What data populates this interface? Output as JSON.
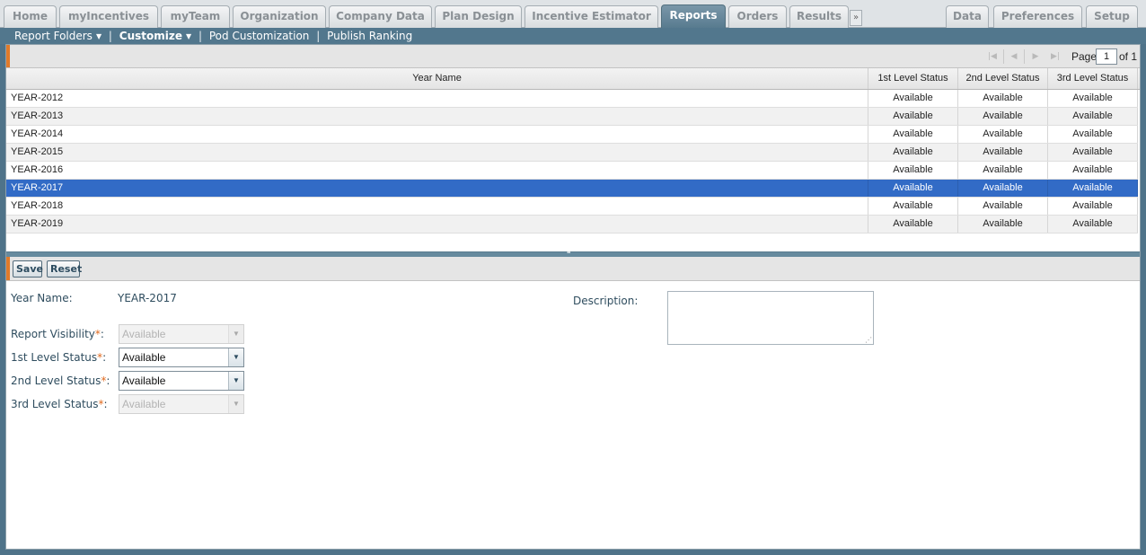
{
  "nav": {
    "tabs_left": [
      "Home",
      "myIncentives",
      "myTeam",
      "Organization",
      "Company Data",
      "Plan Design",
      "Incentive Estimator",
      "Reports",
      "Orders",
      "Results"
    ],
    "more_label": "»",
    "tabs_right": [
      "Data",
      "Preferences",
      "Setup"
    ],
    "active_tab": "Reports"
  },
  "subnav": {
    "items": [
      "Report Folders",
      "Customize",
      "Pod Customization",
      "Publish Ranking"
    ],
    "separator": "|"
  },
  "pager": {
    "page_label": "Page",
    "current_page": "1",
    "of_label": "of 1"
  },
  "grid": {
    "columns": [
      "Year Name",
      "1st Level Status",
      "2nd Level Status",
      "3rd Level Status"
    ],
    "rows": [
      {
        "name": "YEAR-2012",
        "s1": "Available",
        "s2": "Available",
        "s3": "Available"
      },
      {
        "name": "YEAR-2013",
        "s1": "Available",
        "s2": "Available",
        "s3": "Available"
      },
      {
        "name": "YEAR-2014",
        "s1": "Available",
        "s2": "Available",
        "s3": "Available"
      },
      {
        "name": "YEAR-2015",
        "s1": "Available",
        "s2": "Available",
        "s3": "Available"
      },
      {
        "name": "YEAR-2016",
        "s1": "Available",
        "s2": "Available",
        "s3": "Available"
      },
      {
        "name": "YEAR-2017",
        "s1": "Available",
        "s2": "Available",
        "s3": "Available"
      },
      {
        "name": "YEAR-2018",
        "s1": "Available",
        "s2": "Available",
        "s3": "Available"
      },
      {
        "name": "YEAR-2019",
        "s1": "Available",
        "s2": "Available",
        "s3": "Available"
      }
    ],
    "selected_row": 5
  },
  "form_toolbar": {
    "save_label": "Save",
    "reset_label": "Reset"
  },
  "form": {
    "year_name_label": "Year Name:",
    "year_name_value": "YEAR-2017",
    "description_label": "Description:",
    "description_value": "",
    "required_mark": "*",
    "report_visibility": {
      "label": "Report Visibility",
      "value": "Available",
      "disabled": true
    },
    "level1": {
      "label": "1st Level Status",
      "value": "Available",
      "disabled": false
    },
    "level2": {
      "label": "2nd Level Status",
      "value": "Available",
      "disabled": false
    },
    "level3": {
      "label": "3rd Level Status",
      "value": "Available",
      "disabled": true
    }
  },
  "colors": {
    "frame": "#4f7389",
    "active_tab": "#6a8ba0",
    "selected_row": "#326bc6",
    "accent_orange": "#e07a2a",
    "required": "#e06a1f"
  }
}
